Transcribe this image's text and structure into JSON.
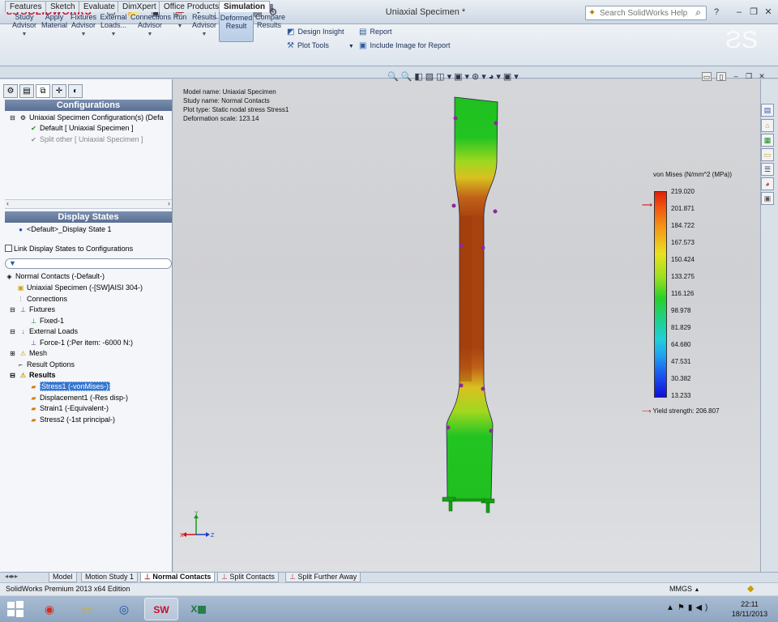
{
  "app": {
    "brand": "SOLIDWORKS",
    "doc_title": "Uniaxial Specimen *",
    "help_search_placeholder": "Search SolidWorks Help"
  },
  "command_manager": {
    "buttons": [
      {
        "label1": "Study",
        "label2": "Advisor"
      },
      {
        "label1": "Apply",
        "label2": "Material"
      },
      {
        "label1": "Fixtures",
        "label2": "Advisor"
      },
      {
        "label1": "External",
        "label2": "Loads..."
      },
      {
        "label1": "Connections",
        "label2": "Advisor"
      },
      {
        "label1": "Run",
        "label2": ""
      },
      {
        "label1": "Results",
        "label2": "Advisor"
      },
      {
        "label1": "Deformed",
        "label2": "Result"
      },
      {
        "label1": "Compare",
        "label2": "Results"
      }
    ],
    "small": {
      "design_insight": "Design Insight",
      "plot_tools": "Plot Tools",
      "report": "Report",
      "include_image": "Include Image for Report"
    }
  },
  "tabs": [
    "Features",
    "Sketch",
    "Evaluate",
    "DimXpert",
    "Office Products",
    "Simulation"
  ],
  "configurations": {
    "header": "Configurations",
    "root": "Uniaxial Specimen Configuration(s)  (Defa",
    "items": [
      "Default [ Uniaxial Specimen ]",
      "Split other [ Uniaxial Specimen ]"
    ]
  },
  "display_states": {
    "header": "Display States",
    "item": "<Default>_Display State 1",
    "link_label": "Link Display States to Configurations"
  },
  "study_tree": {
    "items": [
      "Normal Contacts (-Default-)",
      "Uniaxial Specimen (-[SW]AISI 304-)",
      "Connections",
      "Fixtures",
      "Fixed-1",
      "External Loads",
      "Force-1 (:Per item: -6000 N:)",
      "Mesh",
      "Result Options",
      "Results",
      "Stress1 (-vonMises-)",
      "Displacement1 (-Res disp-)",
      "Strain1 (-Equivalent-)",
      "Stress2 (-1st principal-)"
    ]
  },
  "plot_info": {
    "model_name": "Model name: Uniaxial Specimen",
    "study_name": "Study name: Normal Contacts",
    "plot_type": "Plot type: Static nodal stress Stress1",
    "deformation_scale": "Deformation scale: 123.14"
  },
  "legend": {
    "title": "von Mises (N/mm^2 (MPa))",
    "values": [
      "219.020",
      "201.871",
      "184.722",
      "167.573",
      "150.424",
      "133.275",
      "116.126",
      "98.978",
      "81.829",
      "64.680",
      "47.531",
      "30.382",
      "13.233"
    ],
    "yield_label": "Yield strength: 206.807",
    "colors": {
      "max": "#e0200a",
      "min": "#1010d8"
    }
  },
  "triad": {
    "y": "Y",
    "x": "X",
    "z": "Z"
  },
  "model_tabs": [
    "Model",
    "Motion Study 1",
    "Normal Contacts",
    "Split Contacts",
    "Split Further Away"
  ],
  "status": {
    "edition": "SolidWorks Premium 2013 x64 Edition",
    "units": "MMGS"
  },
  "taskbar": {
    "time": "22:11",
    "date": "18/11/2013"
  }
}
